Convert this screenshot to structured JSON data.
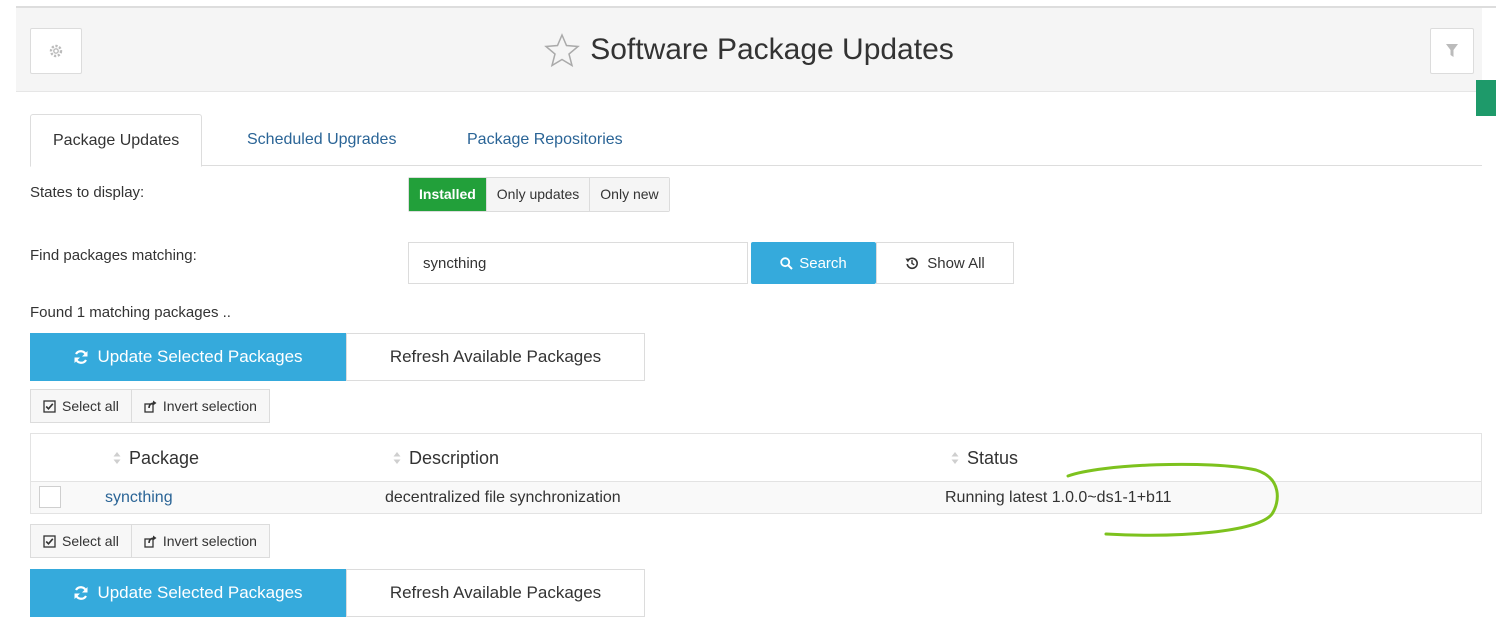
{
  "header": {
    "title": "Software Package Updates"
  },
  "tabs": [
    {
      "label": "Package Updates",
      "active": true
    },
    {
      "label": "Scheduled Upgrades",
      "active": false
    },
    {
      "label": "Package Repositories",
      "active": false
    }
  ],
  "states": {
    "label": "States to display:",
    "options": [
      "Installed",
      "Only updates",
      "Only new"
    ],
    "selected": "Installed"
  },
  "find": {
    "label": "Find packages matching:",
    "value": "syncthing",
    "search_label": "Search",
    "show_all_label": "Show All"
  },
  "found_text": "Found 1 matching packages ..",
  "actions": {
    "update_label": "Update Selected Packages",
    "refresh_label": "Refresh Available Packages"
  },
  "selection": {
    "select_all": "Select all",
    "invert": "Invert selection"
  },
  "table": {
    "columns": [
      "Package",
      "Description",
      "Status"
    ],
    "rows": [
      {
        "package": "syncthing",
        "description": "decentralized file synchronization",
        "status": "Running latest 1.0.0~ds1-1+b11"
      }
    ]
  },
  "colors": {
    "primary": "#35aadc",
    "installed_green": "#22a03a",
    "link": "#2a6496",
    "annotation": "#7dc21e"
  },
  "icons": {
    "settings": "gear-icon",
    "favorite": "star-outline-icon",
    "filter": "filter-icon",
    "search": "search-icon",
    "show_all": "history-icon",
    "update": "refresh-icon",
    "select_all": "check-square-icon",
    "invert": "share-icon",
    "sort": "sort-icon"
  }
}
